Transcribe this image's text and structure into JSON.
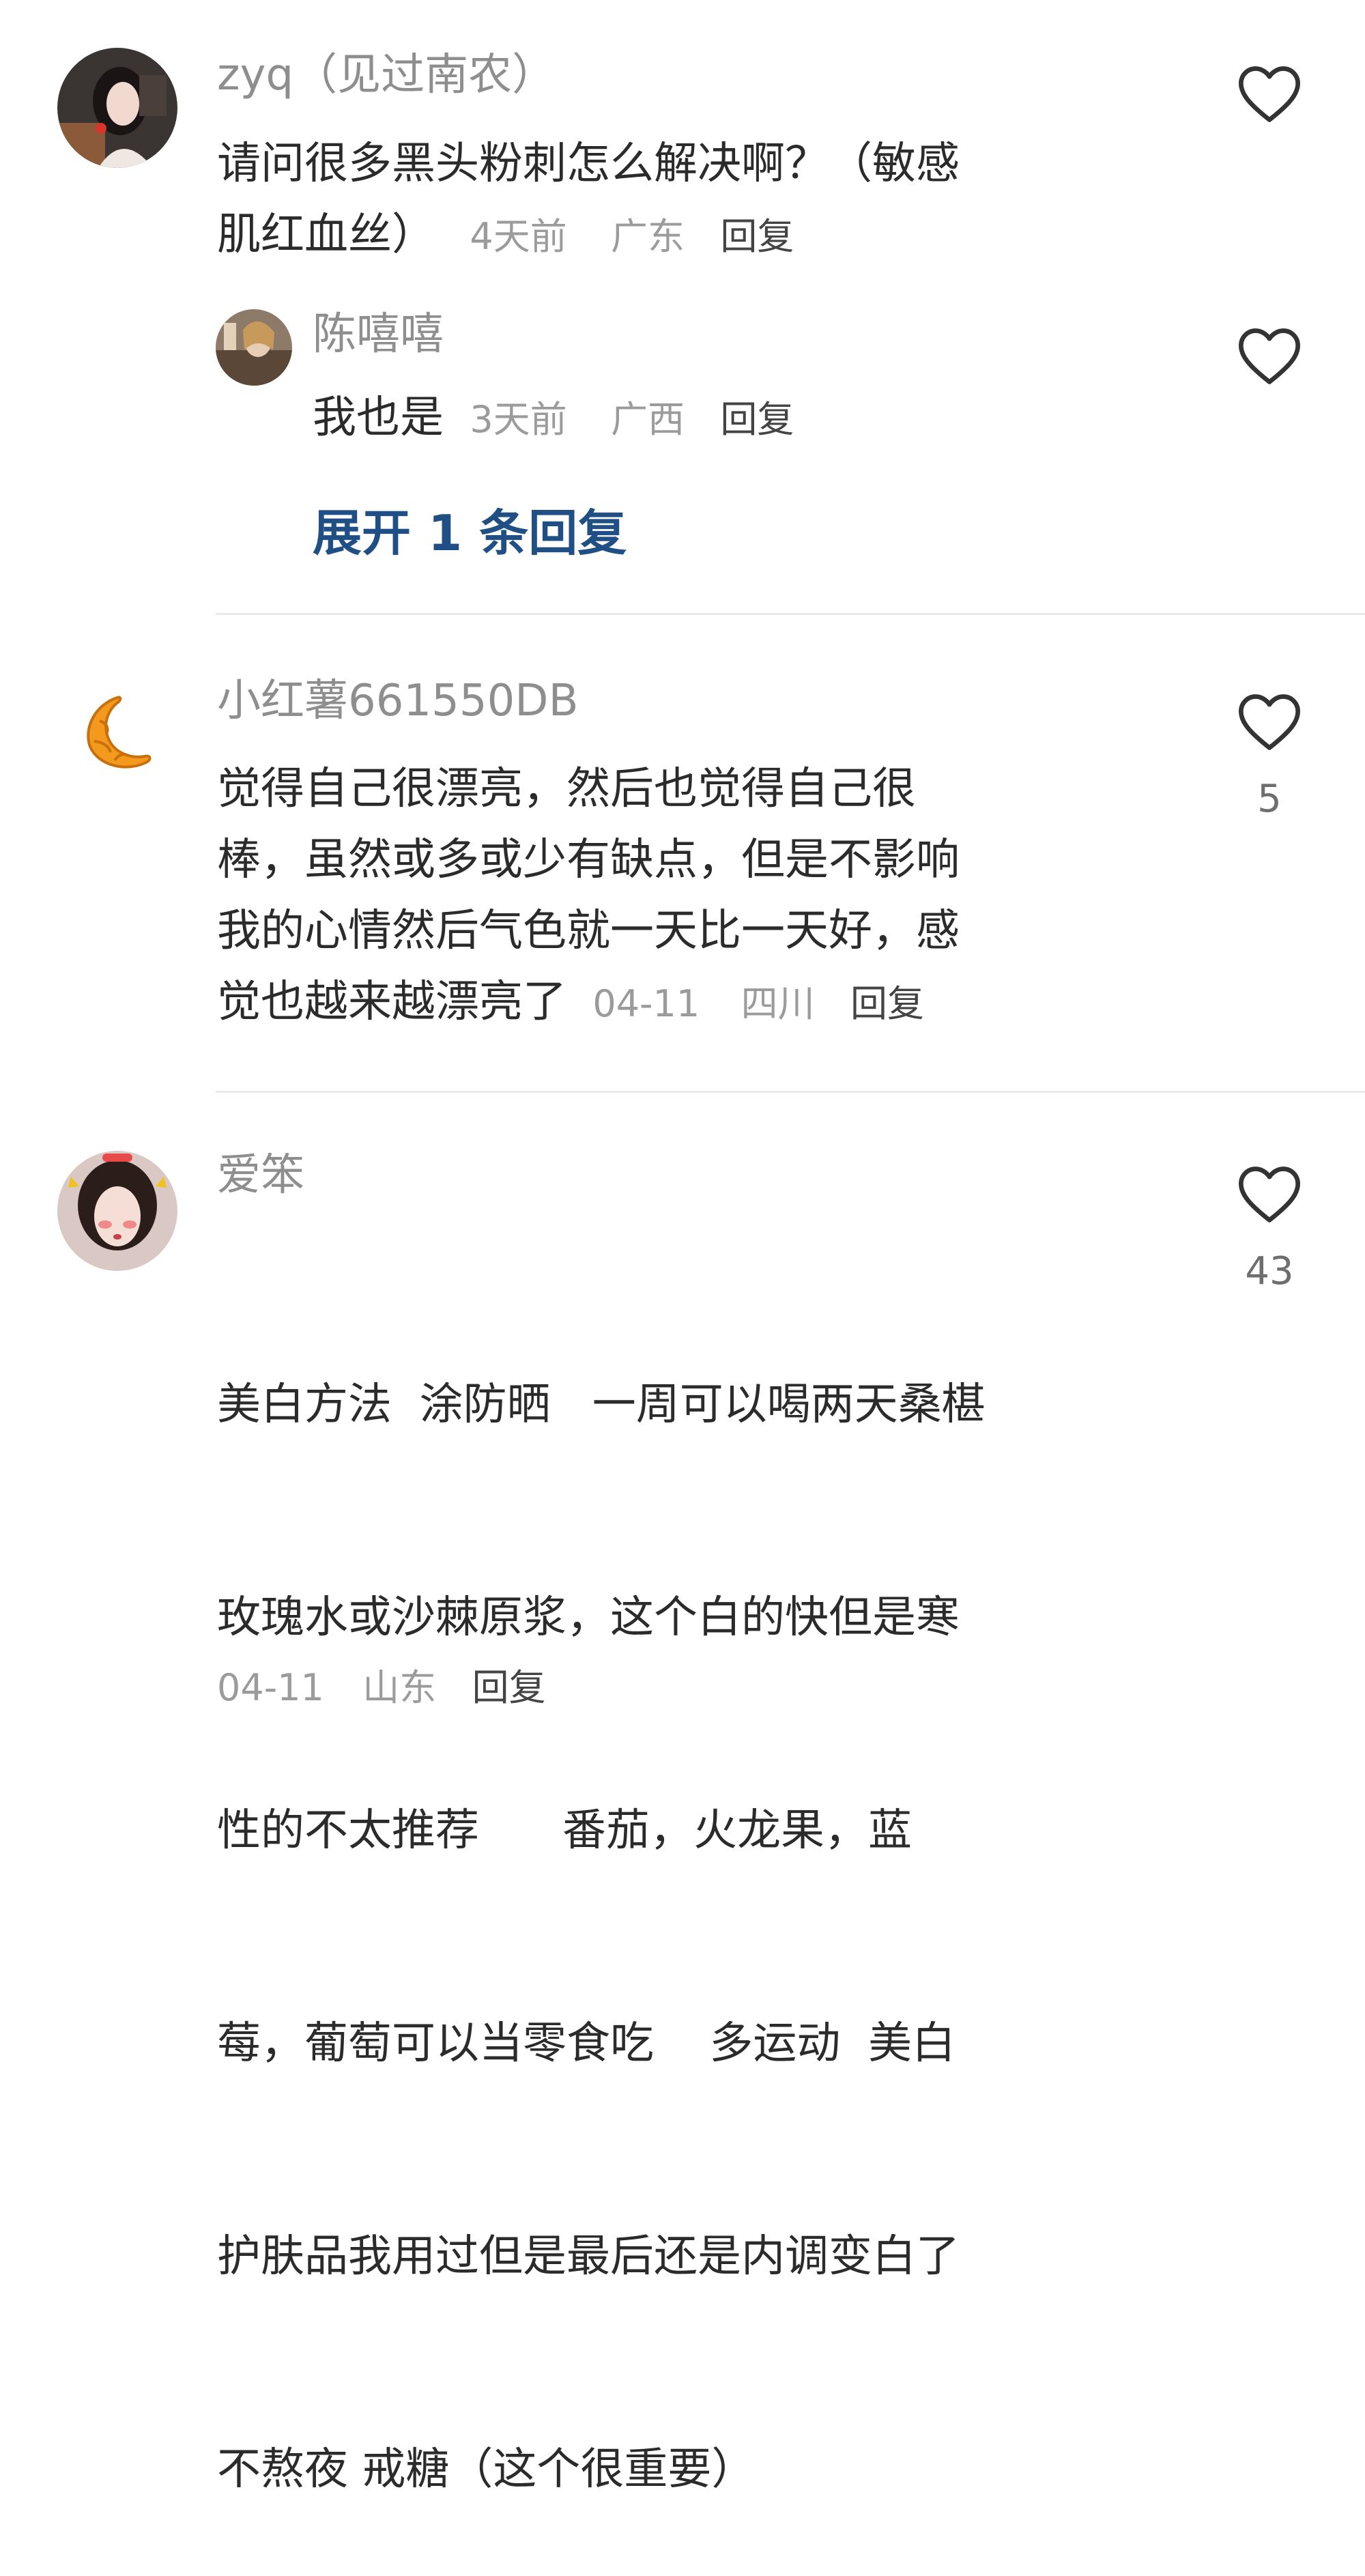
{
  "comments": [
    {
      "username": "zyq（见过南农）",
      "line1": "请问很多黑头粉刺怎么解决啊？（敏感",
      "line2": "肌红血丝）",
      "time": "4天前",
      "location": "广东",
      "reply": "回复",
      "likes": "",
      "replies": [
        {
          "username": "陈嘻嘻",
          "text": "我也是",
          "time": "3天前",
          "location": "广西",
          "reply": "回复"
        }
      ],
      "expand_label": "展开 1 条回复"
    },
    {
      "username": "小红薯661550DB",
      "lines": [
        "觉得自己很漂亮，然后也觉得自己很",
        "棒，虽然或多或少有缺点，但是不影响",
        "我的心情然后气色就一天比一天好，感",
        "觉也越来越漂亮了"
      ],
      "time": "04-11",
      "location": "四川",
      "reply": "回复",
      "likes": "5"
    },
    {
      "username": "爱笨",
      "lines": [
        "美白方法  涂防晒   一周可以喝两天桑椹",
        "玫瑰水或沙棘原浆，这个白的快但是寒",
        "性的不太推荐      番茄，火龙果，蓝",
        "莓，葡萄可以当零食吃    多运动  美白",
        "护肤品我用过但是最后还是内调变白了",
        "不熬夜 戒糖（这个很重要）"
      ],
      "time": "04-11",
      "location": "山东",
      "reply": "回复",
      "likes": "43"
    }
  ],
  "colors": {
    "text": "#2b2b2b",
    "username": "#8e8e8e",
    "meta": "#9b9b9b",
    "expand_link": "#1f4f85",
    "divider": "#e9e9e9",
    "heart_stroke": "#333333",
    "croissant": "#f39a1e"
  }
}
